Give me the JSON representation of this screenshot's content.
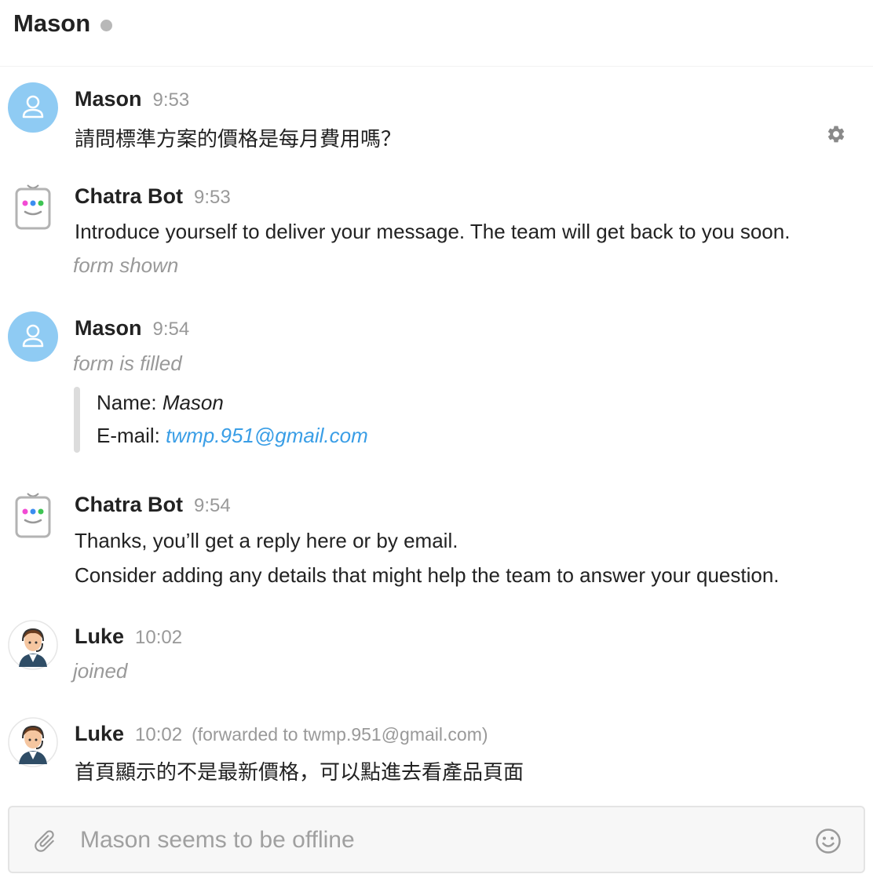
{
  "header": {
    "title": "Mason"
  },
  "messages": [
    {
      "author": "Mason",
      "time": "9:53",
      "text": "請問標準方案的價格是每月費用嗎？"
    },
    {
      "author": "Chatra Bot",
      "time": "9:53",
      "text": "Introduce yourself to deliver your message. The team will get back to you soon.",
      "system": "form shown"
    },
    {
      "author": "Mason",
      "time": "9:54",
      "system": "form is filled",
      "form": {
        "name_label": "Name:",
        "name_value": "Mason",
        "email_label": "E-mail:",
        "email_value": "twmp.951@gmail.com"
      }
    },
    {
      "author": "Chatra Bot",
      "time": "9:54",
      "text_line1": "Thanks, you’ll get a reply here or by email.",
      "text_line2": "Consider adding any details that might help the team to answer your question."
    },
    {
      "author": "Luke",
      "time": "10:02",
      "system": "joined"
    },
    {
      "author": "Luke",
      "time": "10:02",
      "forwarded": "(forwarded to twmp.951@gmail.com)",
      "text": "首頁顯示的不是最新價格，可以點進去看產品頁面"
    }
  ],
  "composer": {
    "placeholder": "Mason seems to be offline"
  },
  "icons": {
    "settings": "gear-icon",
    "attach": "paperclip-icon",
    "emoji": "smiley-icon"
  },
  "colors": {
    "user_avatar": "#8fcbf3",
    "link": "#3a9ee6",
    "status_offline": "#b8b8b8"
  }
}
